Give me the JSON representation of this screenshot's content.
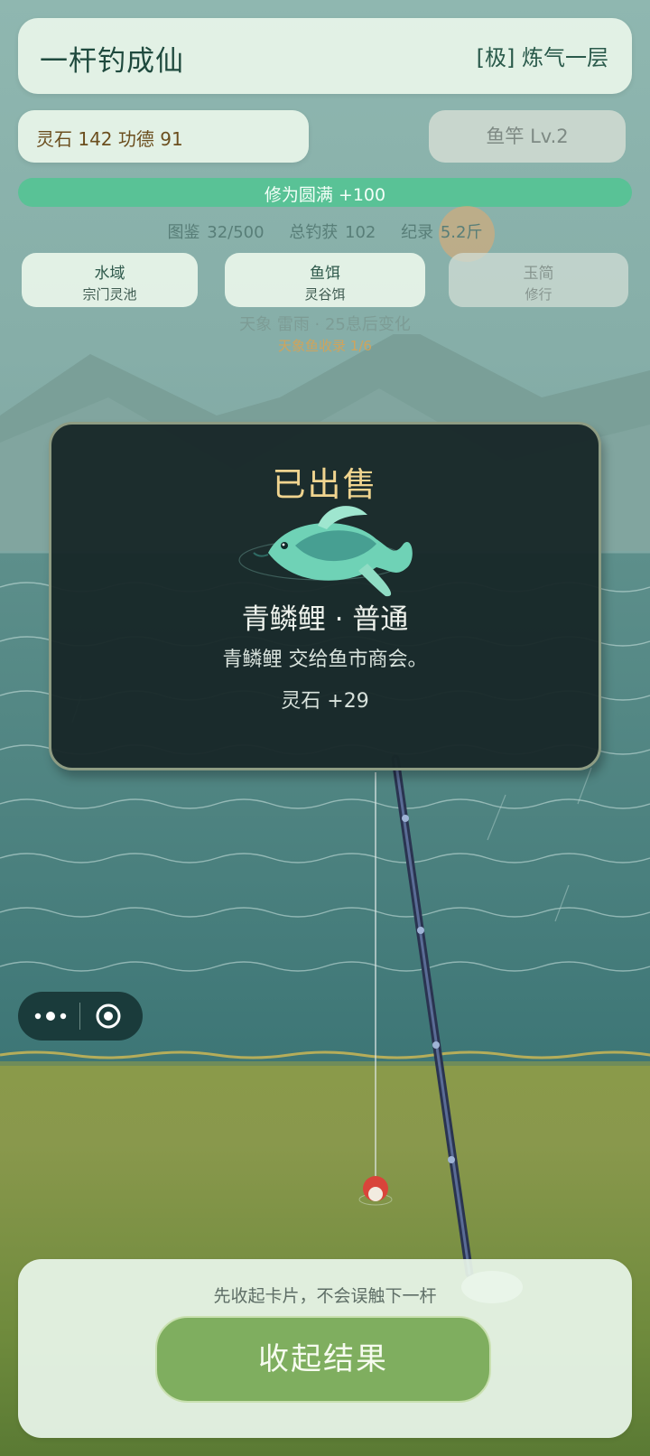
{
  "header": {
    "title": "一杆钓成仙",
    "realm": "[极] 炼气一层"
  },
  "resources": {
    "text": "灵石 142  功德 91"
  },
  "rod": {
    "label": "鱼竿 Lv.2"
  },
  "progress": {
    "text": "修为圆满 +100",
    "percent": 100
  },
  "stats": {
    "collection": "图鉴 32/500",
    "total": "总钓获 102",
    "record": "纪录 5.2斤"
  },
  "chips": [
    {
      "title": "水域",
      "value": "宗门灵池"
    },
    {
      "title": "鱼饵",
      "value": "灵谷饵"
    },
    {
      "title": "玉简",
      "value": "修行"
    }
  ],
  "weather": {
    "text": "天象 雷雨 · 25息后变化",
    "progress": "天象鱼收录 1/6"
  },
  "result": {
    "title": "已出售",
    "fish": "青鳞鲤 · 普通",
    "desc": "青鳞鲤 交给鱼市商会。",
    "reward": "灵石 +29"
  },
  "bottom": {
    "hint": "先收起卡片，不会误触下一杆",
    "button": "收起结果"
  },
  "colors": {
    "accent": "#59c296",
    "button": "#7fae5f",
    "title_gold": "#f0d48f"
  }
}
